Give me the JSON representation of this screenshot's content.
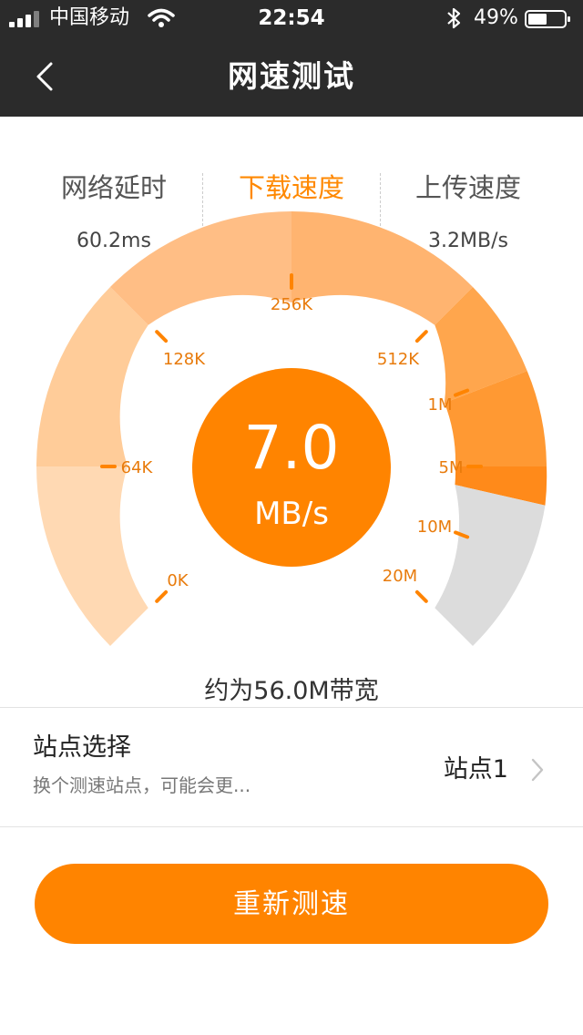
{
  "status_bar": {
    "carrier": "中国移动",
    "time": "22:54",
    "battery": "49%",
    "icons": [
      "signal-icon",
      "wifi-icon",
      "bluetooth-icon",
      "battery-icon"
    ]
  },
  "nav": {
    "back_icon": "chevron-left-icon",
    "title": "网速测试"
  },
  "tabs": [
    {
      "label": "网络延时",
      "value": "60.2ms",
      "active": false
    },
    {
      "label": "下载速度",
      "value": "",
      "active": true
    },
    {
      "label": "上传速度",
      "value": "3.2MB/s",
      "active": false
    }
  ],
  "gauge": {
    "tick_labels": [
      "0K",
      "64K",
      "128K",
      "256K",
      "512K",
      "1M",
      "5M",
      "10M",
      "20M"
    ],
    "value": "7.0",
    "unit": "MB/s",
    "colors": {
      "accent": "#ff8400",
      "track": "#dcdcdc"
    }
  },
  "bandwidth_text": "约为56.0M带宽",
  "site": {
    "title": "站点选择",
    "subtitle": "换个测速站点，可能会更...",
    "value": "站点1",
    "chevron_icon": "chevron-right-icon"
  },
  "retest_button": "重新测速"
}
